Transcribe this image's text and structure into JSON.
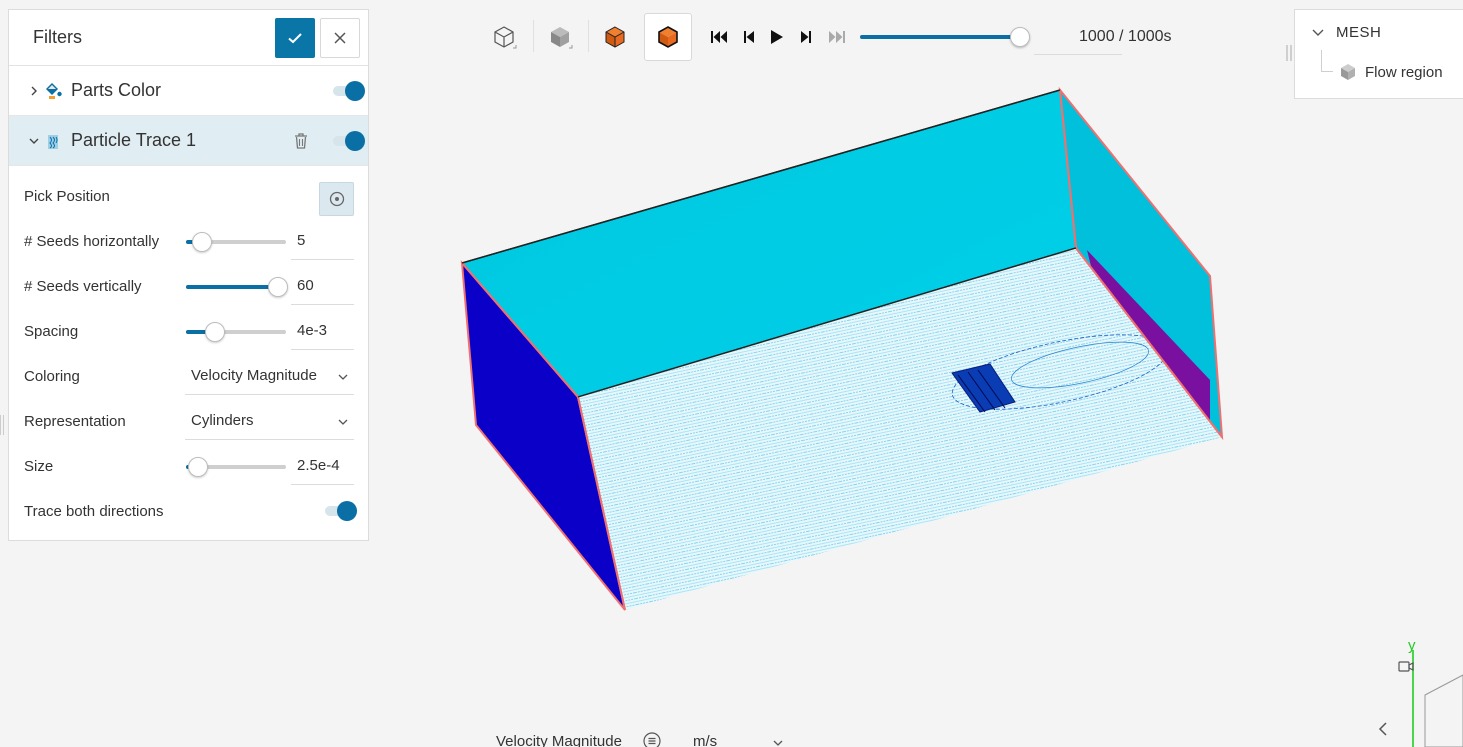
{
  "filters": {
    "title": "Filters",
    "apply_label": "Apply",
    "close_label": "Close",
    "items": [
      {
        "label": "Parts Color",
        "enabled": true,
        "expanded": false
      },
      {
        "label": "Particle Trace 1",
        "enabled": true,
        "expanded": true
      }
    ],
    "properties": {
      "pick_position": {
        "label": "Pick Position"
      },
      "seeds_horizontally": {
        "label": "# Seeds horizontally",
        "value": "5",
        "fraction": 0.16
      },
      "seeds_vertically": {
        "label": "# Seeds vertically",
        "value": "60",
        "fraction": 0.92
      },
      "spacing": {
        "label": "Spacing",
        "value": "4e-3",
        "fraction": 0.29
      },
      "coloring": {
        "label": "Coloring",
        "value": "Velocity Magnitude"
      },
      "representation": {
        "label": "Representation",
        "value": "Cylinders"
      },
      "size": {
        "label": "Size",
        "value": "2.5e-4",
        "fraction": 0.12
      },
      "trace_both": {
        "label": "Trace both directions",
        "enabled": true
      }
    }
  },
  "toolbar": {
    "time": {
      "display": "1000 / 1000s",
      "fraction": 1.0
    }
  },
  "mesh": {
    "title": "MESH",
    "items": [
      {
        "label": "Flow region"
      }
    ]
  },
  "legend": {
    "label": "Velocity Magnitude",
    "unit": "m/s"
  },
  "axes": {
    "y_label": "y"
  },
  "colors": {
    "accent": "#0a6fa5",
    "wall_top": "#00c8e0",
    "wall_end": "#0a00c8",
    "outline": "#f07070",
    "stream": "#1eb4e0",
    "obstacle": "#0a3cb4"
  }
}
